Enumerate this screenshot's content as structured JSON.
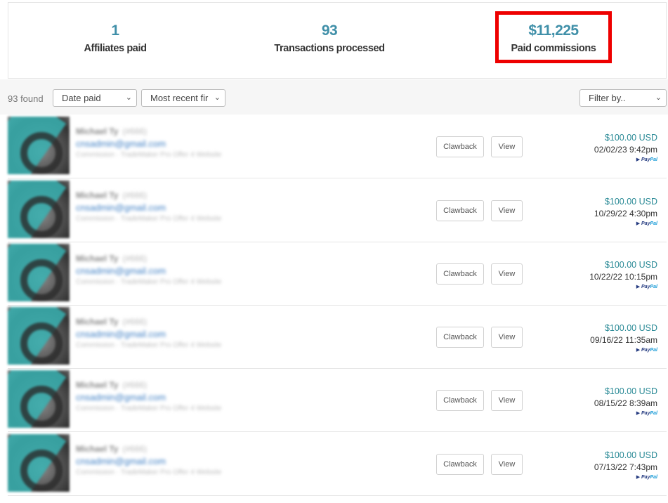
{
  "stats": [
    {
      "value": "1",
      "label": "Affiliates paid"
    },
    {
      "value": "93",
      "label": "Transactions processed"
    },
    {
      "value": "$11,225",
      "label": "Paid commissions"
    }
  ],
  "toolbar": {
    "found": "93 found",
    "sort_field": "Date paid",
    "sort_order": "Most recent fir",
    "filter": "Filter by.."
  },
  "actions": {
    "clawback": "Clawback",
    "view": "View"
  },
  "rows": [
    {
      "name": "Michael Ty",
      "tag": "(#666)",
      "email": "cnsadmin@gmail.com",
      "meta": "Commission · TradeMaker Pro Offer 4 Website",
      "amount": "$100.00 USD",
      "date": "02/02/23 9:42pm",
      "method_a": "Pay",
      "method_b": "Pal"
    },
    {
      "name": "Michael Ty",
      "tag": "(#666)",
      "email": "cnsadmin@gmail.com",
      "meta": "Commission · TradeMaker Pro Offer 4 Website",
      "amount": "$100.00 USD",
      "date": "10/29/22 4:30pm",
      "method_a": "Pay",
      "method_b": "Pal"
    },
    {
      "name": "Michael Ty",
      "tag": "(#666)",
      "email": "cnsadmin@gmail.com",
      "meta": "Commission · TradeMaker Pro Offer 4 Website",
      "amount": "$100.00 USD",
      "date": "10/22/22 10:15pm",
      "method_a": "Pay",
      "method_b": "Pal"
    },
    {
      "name": "Michael Ty",
      "tag": "(#666)",
      "email": "cnsadmin@gmail.com",
      "meta": "Commission · TradeMaker Pro Offer 4 Website",
      "amount": "$100.00 USD",
      "date": "09/16/22 11:35am",
      "method_a": "Pay",
      "method_b": "Pal"
    },
    {
      "name": "Michael Ty",
      "tag": "(#666)",
      "email": "cnsadmin@gmail.com",
      "meta": "Commission · TradeMaker Pro Offer 4 Website",
      "amount": "$100.00 USD",
      "date": "08/15/22 8:39am",
      "method_a": "Pay",
      "method_b": "Pal"
    },
    {
      "name": "Michael Ty",
      "tag": "(#666)",
      "email": "cnsadmin@gmail.com",
      "meta": "Commission · TradeMaker Pro Offer 4 Website",
      "amount": "$100.00 USD",
      "date": "07/13/22 7:43pm",
      "method_a": "Pay",
      "method_b": "Pal"
    }
  ]
}
